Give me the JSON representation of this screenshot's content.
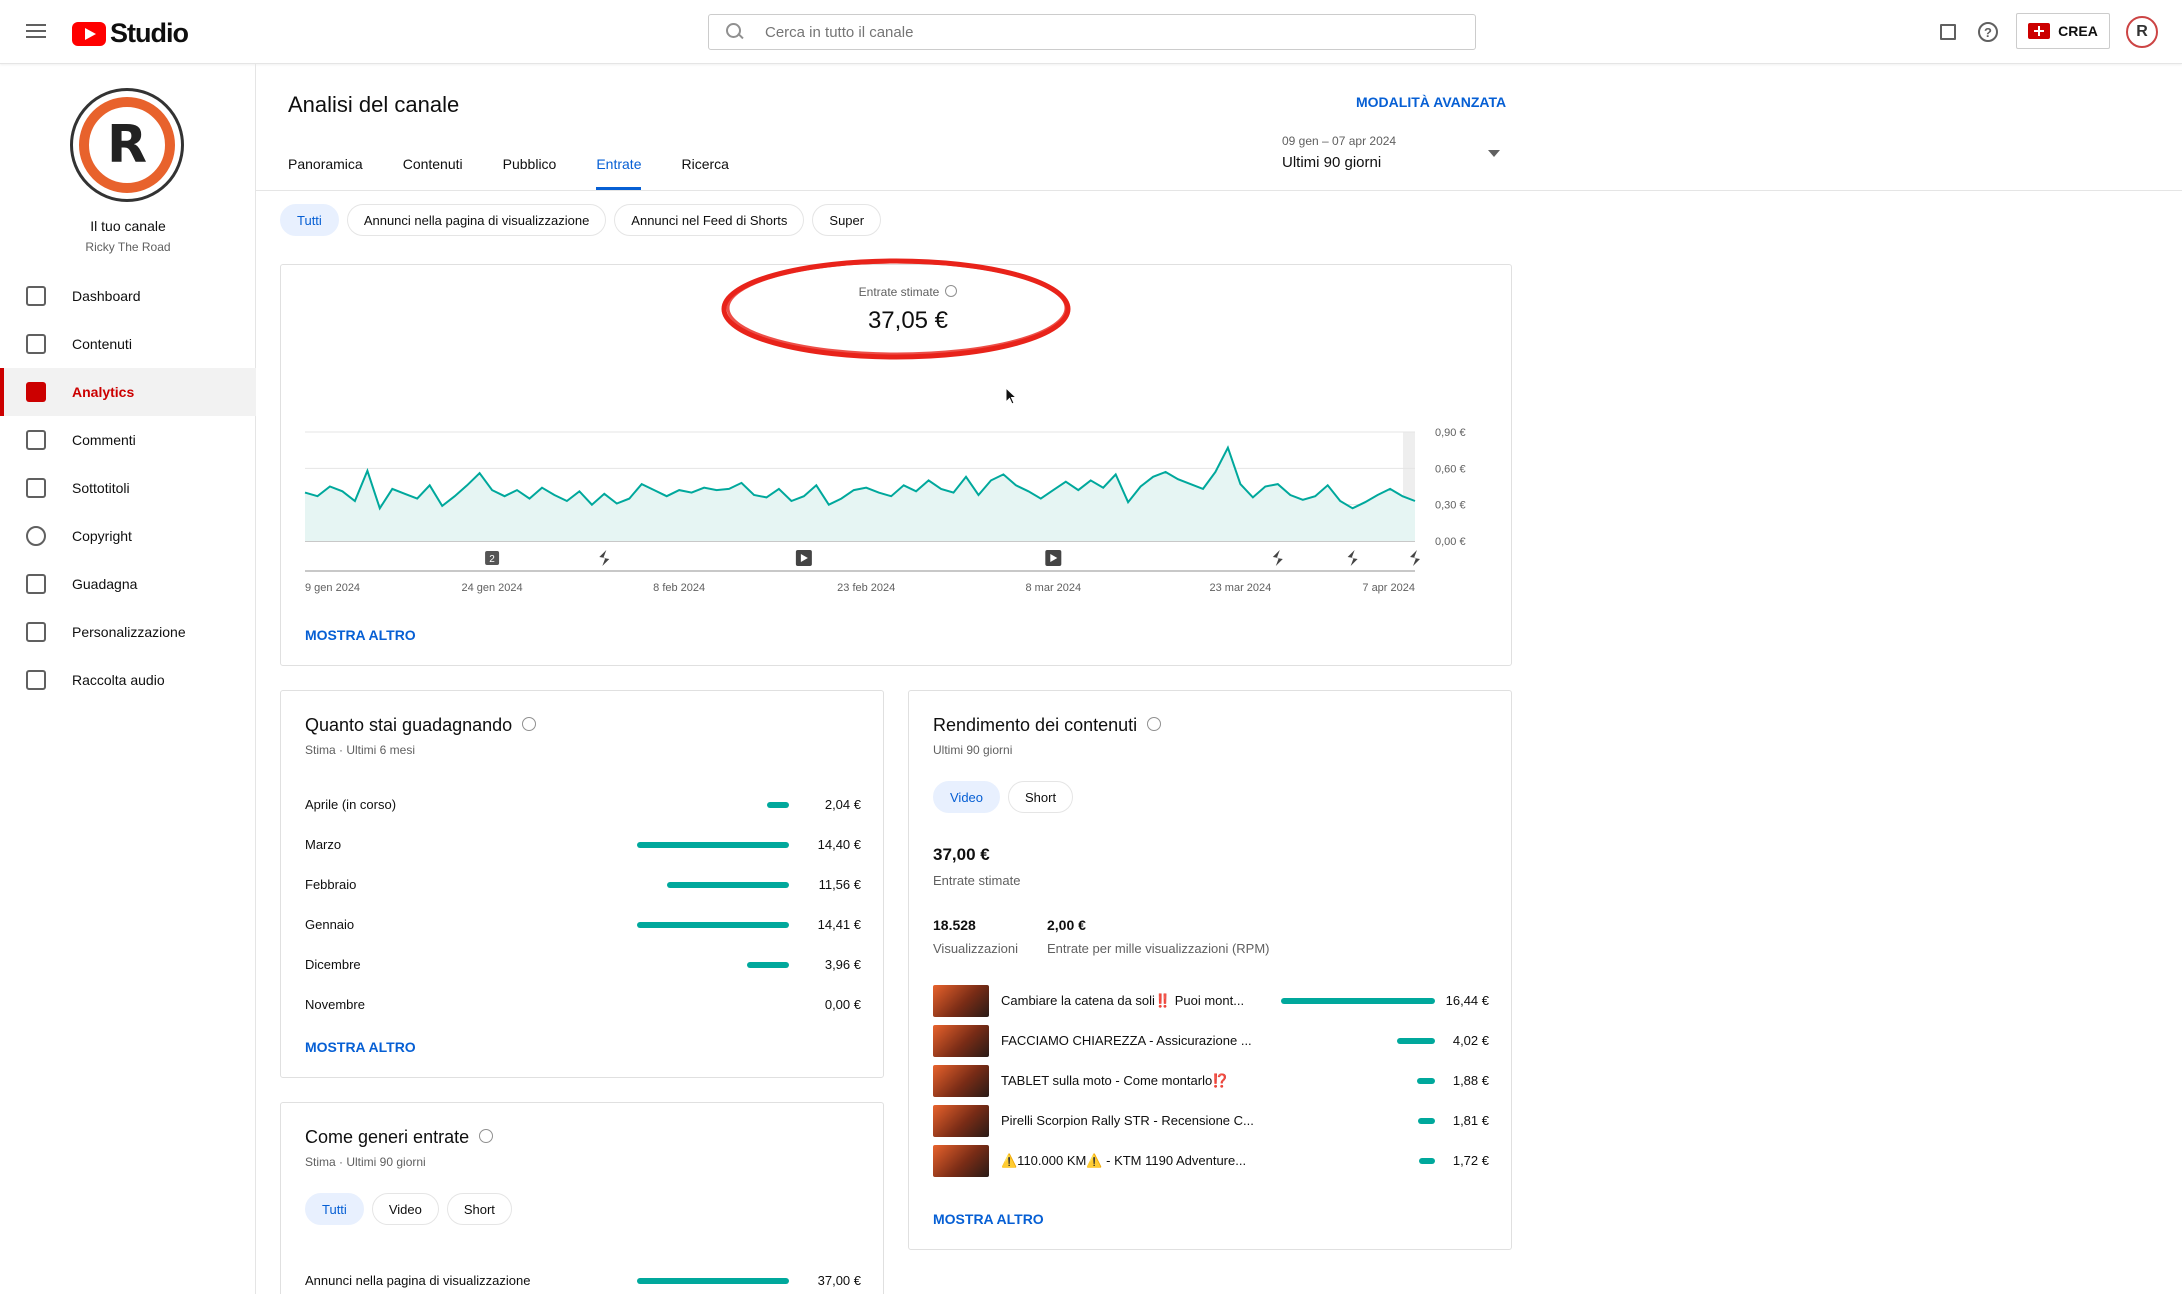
{
  "header": {
    "logo_text": "Studio",
    "search_placeholder": "Cerca in tutto il canale",
    "create_label": "CREA",
    "avatar_letter": "R"
  },
  "sidebar": {
    "avatar_letter": "R",
    "channel_title": "Il tuo canale",
    "channel_name": "Ricky The Road",
    "items": [
      {
        "label": "Dashboard",
        "icon": "dashboard-icon"
      },
      {
        "label": "Contenuti",
        "icon": "content-icon"
      },
      {
        "label": "Analytics",
        "icon": "analytics-icon"
      },
      {
        "label": "Commenti",
        "icon": "comments-icon"
      },
      {
        "label": "Sottotitoli",
        "icon": "subtitles-icon"
      },
      {
        "label": "Copyright",
        "icon": "copyright-icon"
      },
      {
        "label": "Guadagna",
        "icon": "dollar-icon"
      },
      {
        "label": "Personalizzazione",
        "icon": "wand-icon"
      },
      {
        "label": "Raccolta audio",
        "icon": "audio-library-icon"
      }
    ],
    "active_index": 2
  },
  "main": {
    "title": "Analisi del canale",
    "advanced_mode": "MODALITÀ AVANZATA",
    "tabs": [
      "Panoramica",
      "Contenuti",
      "Pubblico",
      "Entrate",
      "Ricerca"
    ],
    "active_tab": 3,
    "date_range_sub": "09 gen – 07 apr 2024",
    "date_range_main": "Ultimi 90 giorni",
    "filter_chips": [
      "Tutti",
      "Annunci nella pagina di visualizzazione",
      "Annunci nel Feed di Shorts",
      "Super"
    ],
    "active_chip": 0
  },
  "revenue_card": {
    "metric_label": "Entrate stimate",
    "metric_value": "37,05 €",
    "show_more": "MOSTRA ALTRO"
  },
  "chart_data": {
    "type": "area",
    "ylabel_ticks": [
      "0,90 €",
      "0,60 €",
      "0,30 €",
      "0,00 €"
    ],
    "ylim": [
      0,
      0.9
    ],
    "x_tick_labels": [
      "9 gen 2024",
      "24 gen 2024",
      "8 feb 2024",
      "23 feb 2024",
      "8 mar 2024",
      "23 mar 2024",
      "7 apr 2024"
    ],
    "series": [
      {
        "values": [
          0.4,
          0.37,
          0.45,
          0.41,
          0.33,
          0.58,
          0.27,
          0.43,
          0.39,
          0.35,
          0.46,
          0.29,
          0.37,
          0.46,
          0.56,
          0.42,
          0.37,
          0.42,
          0.35,
          0.44,
          0.38,
          0.33,
          0.41,
          0.3,
          0.39,
          0.31,
          0.35,
          0.47,
          0.42,
          0.37,
          0.42,
          0.4,
          0.44,
          0.42,
          0.43,
          0.48,
          0.38,
          0.36,
          0.43,
          0.33,
          0.37,
          0.46,
          0.3,
          0.35,
          0.42,
          0.44,
          0.4,
          0.37,
          0.46,
          0.41,
          0.5,
          0.43,
          0.4,
          0.53,
          0.38,
          0.5,
          0.55,
          0.46,
          0.41,
          0.35,
          0.42,
          0.49,
          0.42,
          0.5,
          0.44,
          0.55,
          0.32,
          0.45,
          0.53,
          0.57,
          0.51,
          0.47,
          0.43,
          0.57,
          0.77,
          0.47,
          0.36,
          0.45,
          0.47,
          0.38,
          0.34,
          0.37,
          0.46,
          0.33,
          0.27,
          0.32,
          0.38,
          0.43,
          0.37,
          0.33
        ],
        "color": "#00a89c"
      }
    ],
    "markers": [
      {
        "label": "2",
        "kind": "number-icon",
        "day": 15
      },
      {
        "kind": "shorts-icon",
        "day": 24
      },
      {
        "kind": "video-icon",
        "day": 40
      },
      {
        "kind": "video-icon",
        "day": 60
      },
      {
        "kind": "shorts-icon",
        "day": 78
      },
      {
        "kind": "shorts-icon",
        "day": 84
      },
      {
        "kind": "shorts-icon",
        "day": 89
      }
    ]
  },
  "earnings_card": {
    "title": "Quanto stai guadagnando",
    "subtitle": "Stima · Ultimi 6 mesi",
    "rows": [
      {
        "label": "Aprile (in corso)",
        "value": "2,04 €",
        "amount": 2.04
      },
      {
        "label": "Marzo",
        "value": "14,40 €",
        "amount": 14.4
      },
      {
        "label": "Febbraio",
        "value": "11,56 €",
        "amount": 11.56
      },
      {
        "label": "Gennaio",
        "value": "14,41 €",
        "amount": 14.41
      },
      {
        "label": "Dicembre",
        "value": "3,96 €",
        "amount": 3.96
      },
      {
        "label": "Novembre",
        "value": "0,00 €",
        "amount": 0
      }
    ],
    "show_more": "MOSTRA ALTRO"
  },
  "performance_card": {
    "title": "Rendimento dei contenuti",
    "subtitle": "Ultimi 90 giorni",
    "chips": [
      "Video",
      "Short"
    ],
    "active_chip": 0,
    "revenue_value": "37,00 €",
    "revenue_label": "Entrate stimate",
    "views_value": "18.528",
    "views_label": "Visualizzazioni",
    "rpm_value": "2,00 €",
    "rpm_label": "Entrate per mille visualizzazioni (RPM)",
    "videos": [
      {
        "title": "Cambiare la catena da soli‼️ Puoi mont...",
        "value": "16,44 €",
        "amount": 16.44
      },
      {
        "title": "FACCIAMO CHIAREZZA - Assicurazione ...",
        "value": "4,02 €",
        "amount": 4.02
      },
      {
        "title": "TABLET sulla moto - Come montarlo⁉️",
        "value": "1,88 €",
        "amount": 1.88
      },
      {
        "title": "Pirelli Scorpion Rally STR - Recensione C...",
        "value": "1,81 €",
        "amount": 1.81
      },
      {
        "title": "⚠️110.000 KM⚠️ - KTM 1190 Adventure...",
        "value": "1,72 €",
        "amount": 1.72
      }
    ],
    "show_more": "MOSTRA ALTRO"
  },
  "sources_card": {
    "title": "Come generi entrate",
    "subtitle": "Stima · Ultimi 90 giorni",
    "chips": [
      "Tutti",
      "Video",
      "Short"
    ],
    "active_chip": 0,
    "rows": [
      {
        "label": "Annunci nella pagina di visualizzazione",
        "value": "37,00 €",
        "amount": 37.0
      }
    ]
  }
}
